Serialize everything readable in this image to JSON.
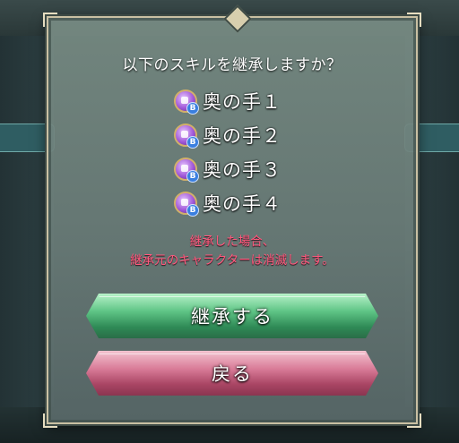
{
  "dialog": {
    "prompt": "以下のスキルを継承しますか？",
    "skills": [
      {
        "name": "奥の手１",
        "badge": "B"
      },
      {
        "name": "奥の手２",
        "badge": "B"
      },
      {
        "name": "奥の手３",
        "badge": "B"
      },
      {
        "name": "奥の手４",
        "badge": "B"
      }
    ],
    "warning_line1": "継承した場合、",
    "warning_line2": "継承元のキャラクターは消滅します。",
    "confirm_label": "継承する",
    "back_label": "戻る"
  },
  "colors": {
    "warning": "#ff5a7e",
    "confirm_button": "#4fb97a",
    "back_button": "#c9627f",
    "dialog_border": "#c9c0a3"
  },
  "icons": {
    "skill_icon": "skill-b-slot-icon"
  }
}
